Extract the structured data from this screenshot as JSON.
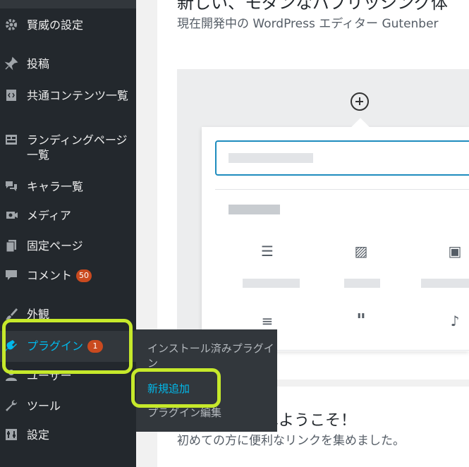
{
  "sidebar": {
    "items": [
      {
        "icon": "gear-icon",
        "label": "賢威の設定"
      },
      {
        "icon": "pin-icon",
        "label": "投稿"
      },
      {
        "icon": "code-block-icon",
        "label": "共通コンテンツ一覧"
      },
      {
        "icon": "layout-icon",
        "label": "ランディングページ一覧"
      },
      {
        "icon": "speech-bubbles-icon",
        "label": "キャラ一覧"
      },
      {
        "icon": "media-icon",
        "label": "メディア"
      },
      {
        "icon": "pages-icon",
        "label": "固定ページ"
      },
      {
        "icon": "comment-icon",
        "label": "コメント",
        "badge": "50"
      },
      {
        "icon": "brush-icon",
        "label": "外観"
      },
      {
        "icon": "plugin-icon",
        "label": "プラグイン",
        "badge": "1"
      },
      {
        "icon": "user-icon",
        "label": "ユーザー"
      },
      {
        "icon": "wrench-icon",
        "label": "ツール"
      },
      {
        "icon": "settings-icon",
        "label": "設定"
      }
    ]
  },
  "flyout": {
    "items": [
      {
        "label": "インストール済みプラグイン"
      },
      {
        "label": "新規追加"
      },
      {
        "label": "プラグイン編集"
      }
    ]
  },
  "editor_promo": {
    "title": "新しい、モダンなパブリッシング体",
    "subtitle": "現在開発中の WordPress エディター Gutenber"
  },
  "welcome": {
    "title": "へようこそ！",
    "subtitle": "初めての方に便利なリンクを集めました。"
  },
  "colors": {
    "sidebar_bg": "#23282d",
    "accent": "#00b9eb",
    "badge": "#ca4a1f",
    "highlight": "#c6e92b"
  }
}
